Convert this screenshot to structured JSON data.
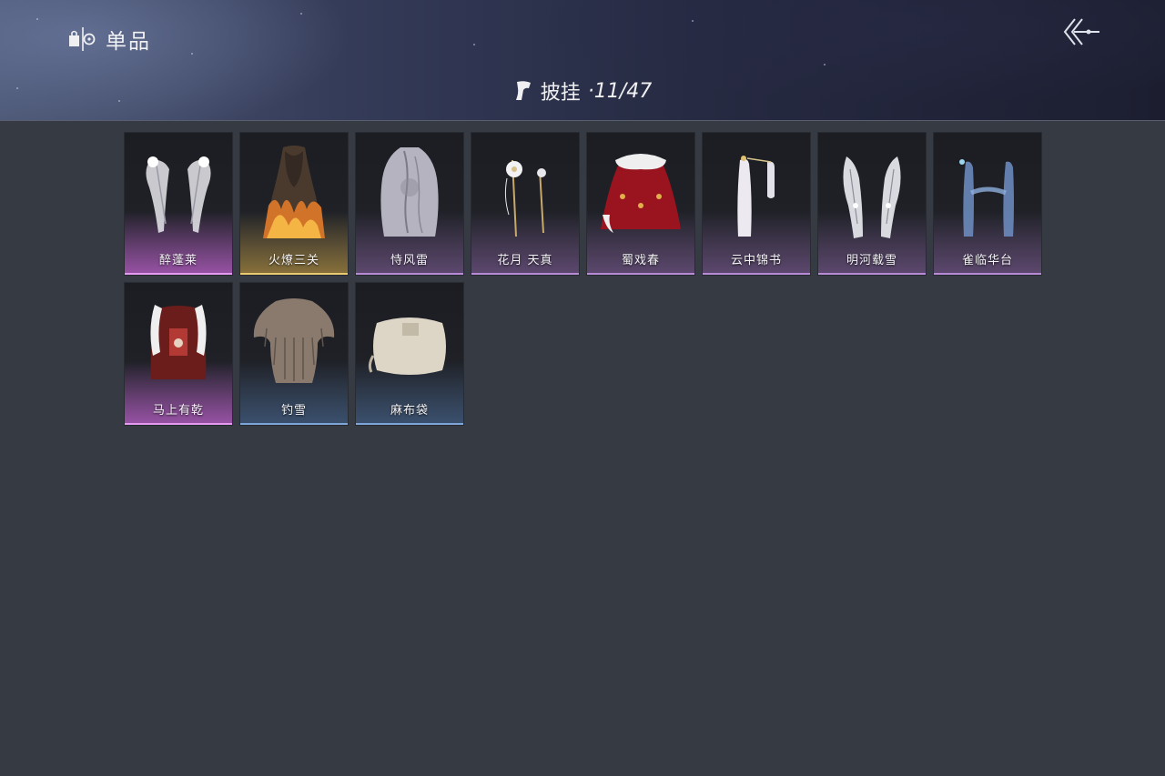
{
  "header": {
    "title": "单品",
    "category_label": "披挂",
    "category_count": "·11/47",
    "brand_icon": "item-icon",
    "back_icon": "back-arrow-icon",
    "category_icon": "cloak-icon"
  },
  "colors": {
    "background": "#363a43",
    "rarity_purple": "#b78bd6",
    "rarity_pink": "#e49af0",
    "rarity_gold": "#e8cb71",
    "rarity_blue": "#7fa6d9"
  },
  "items": [
    {
      "name": "醉蓬莱",
      "rarity": "pink",
      "icon": "feather-wings-icon"
    },
    {
      "name": "火燎三关",
      "rarity": "gold",
      "icon": "flame-cloak-icon"
    },
    {
      "name": "恃风雷",
      "rarity": "purple",
      "icon": "grey-robe-icon"
    },
    {
      "name": "花月 天真",
      "rarity": "purple",
      "icon": "flower-hairpin-icon"
    },
    {
      "name": "蜀戏春",
      "rarity": "purple",
      "icon": "red-fur-cape-icon"
    },
    {
      "name": "云中锦书",
      "rarity": "purple",
      "icon": "white-ribbon-icon"
    },
    {
      "name": "明河载雪",
      "rarity": "purple",
      "icon": "silver-wings-icon"
    },
    {
      "name": "雀临华台",
      "rarity": "purple",
      "icon": "blue-sash-icon"
    },
    {
      "name": "马上有乾",
      "rarity": "pink",
      "icon": "red-fur-coat-icon"
    },
    {
      "name": "钓雪",
      "rarity": "blue",
      "icon": "straw-cape-icon"
    },
    {
      "name": "麻布袋",
      "rarity": "blue",
      "icon": "sack-icon"
    }
  ]
}
